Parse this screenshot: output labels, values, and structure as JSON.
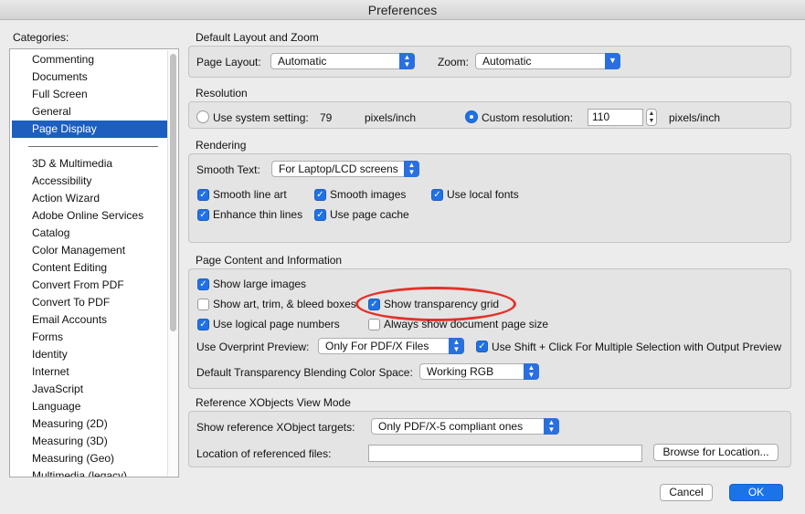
{
  "window": {
    "title": "Preferences"
  },
  "sidebar": {
    "label": "Categories:",
    "top_items": [
      "Commenting",
      "Documents",
      "Full Screen",
      "General",
      "Page Display"
    ],
    "selected": "Page Display",
    "items": [
      "3D & Multimedia",
      "Accessibility",
      "Action Wizard",
      "Adobe Online Services",
      "Catalog",
      "Color Management",
      "Content Editing",
      "Convert From PDF",
      "Convert To PDF",
      "Email Accounts",
      "Forms",
      "Identity",
      "Internet",
      "JavaScript",
      "Language",
      "Measuring (2D)",
      "Measuring (3D)",
      "Measuring (Geo)",
      "Multimedia (legacy)"
    ]
  },
  "layout_zoom": {
    "title": "Default Layout and Zoom",
    "page_layout_label": "Page Layout:",
    "page_layout_value": "Automatic",
    "zoom_label": "Zoom:",
    "zoom_value": "Automatic"
  },
  "resolution": {
    "title": "Resolution",
    "system_label": "Use system setting:",
    "system_value": "79",
    "system_unit": "pixels/inch",
    "custom_label": "Custom resolution:",
    "custom_value": "110",
    "custom_unit": "pixels/inch",
    "selected": "custom"
  },
  "rendering": {
    "title": "Rendering",
    "smooth_text_label": "Smooth Text:",
    "smooth_text_value": "For Laptop/LCD screens",
    "checkboxes": {
      "smooth_line_art": {
        "label": "Smooth line art",
        "checked": true
      },
      "smooth_images": {
        "label": "Smooth images",
        "checked": true
      },
      "use_local_fonts": {
        "label": "Use local fonts",
        "checked": true
      },
      "enhance_thin_lines": {
        "label": "Enhance thin lines",
        "checked": true
      },
      "use_page_cache": {
        "label": "Use page cache",
        "checked": true
      }
    }
  },
  "page_content": {
    "title": "Page Content and Information",
    "checkboxes": {
      "show_large_images": {
        "label": "Show large images",
        "checked": true
      },
      "show_art_trim_bleed": {
        "label": "Show art, trim, & bleed boxes",
        "checked": false
      },
      "show_transparency_grid": {
        "label": "Show transparency grid",
        "checked": true
      },
      "use_logical_page_numbers": {
        "label": "Use logical page numbers",
        "checked": true
      },
      "always_show_page_size": {
        "label": "Always show document page size",
        "checked": false
      },
      "shift_click_selection": {
        "label": "Use Shift + Click For Multiple Selection with Output Preview",
        "checked": true
      }
    },
    "overprint_label": "Use Overprint Preview:",
    "overprint_value": "Only For PDF/X Files",
    "blending_label": "Default Transparency Blending Color Space:",
    "blending_value": "Working RGB"
  },
  "xobjects": {
    "title": "Reference XObjects View Mode",
    "targets_label": "Show reference XObject targets:",
    "targets_value": "Only PDF/X-5 compliant ones",
    "location_label": "Location of referenced files:",
    "location_value": "",
    "browse_label": "Browse for Location..."
  },
  "footer": {
    "cancel_label": "Cancel",
    "ok_label": "OK"
  },
  "colors": {
    "accent": "#1f72e6",
    "selection": "#1d5fbf",
    "annotation": "#e2332a"
  }
}
